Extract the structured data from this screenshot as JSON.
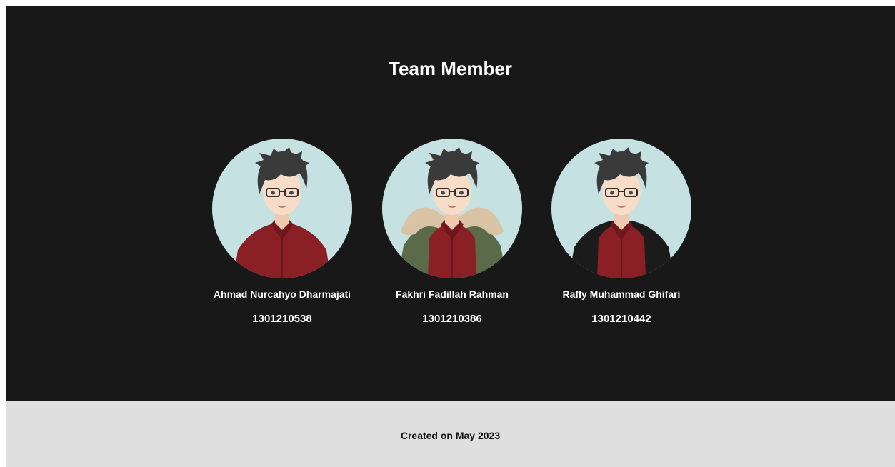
{
  "team": {
    "title": "Team Member",
    "members": [
      {
        "name": "Ahmad Nurcahyo Dharmajati",
        "id": "1301210538",
        "outfit": "red-shirt",
        "avatar_icon": "anime-avatar-glasses-red-shirt"
      },
      {
        "name": "Fakhri Fadillah Rahman",
        "id": "1301210386",
        "outfit": "green-parka-fur-hood",
        "avatar_icon": "anime-avatar-glasses-parka"
      },
      {
        "name": "Rafly Muhammad Ghifari",
        "id": "1301210442",
        "outfit": "black-jacket",
        "avatar_icon": "anime-avatar-glasses-black-jacket"
      }
    ]
  },
  "footer": {
    "text": "Created on May 2023"
  },
  "colors": {
    "section_bg": "#181818",
    "footer_bg": "#dfdfdf",
    "avatar_bg": "#c6e1e2",
    "shirt": "#8b1f26",
    "hair": "#3a3a3a",
    "skin": "#f7dcc8",
    "parka": "#5b6b4a",
    "fur": "#d8c4a4",
    "jacket": "#1b1b1b"
  }
}
